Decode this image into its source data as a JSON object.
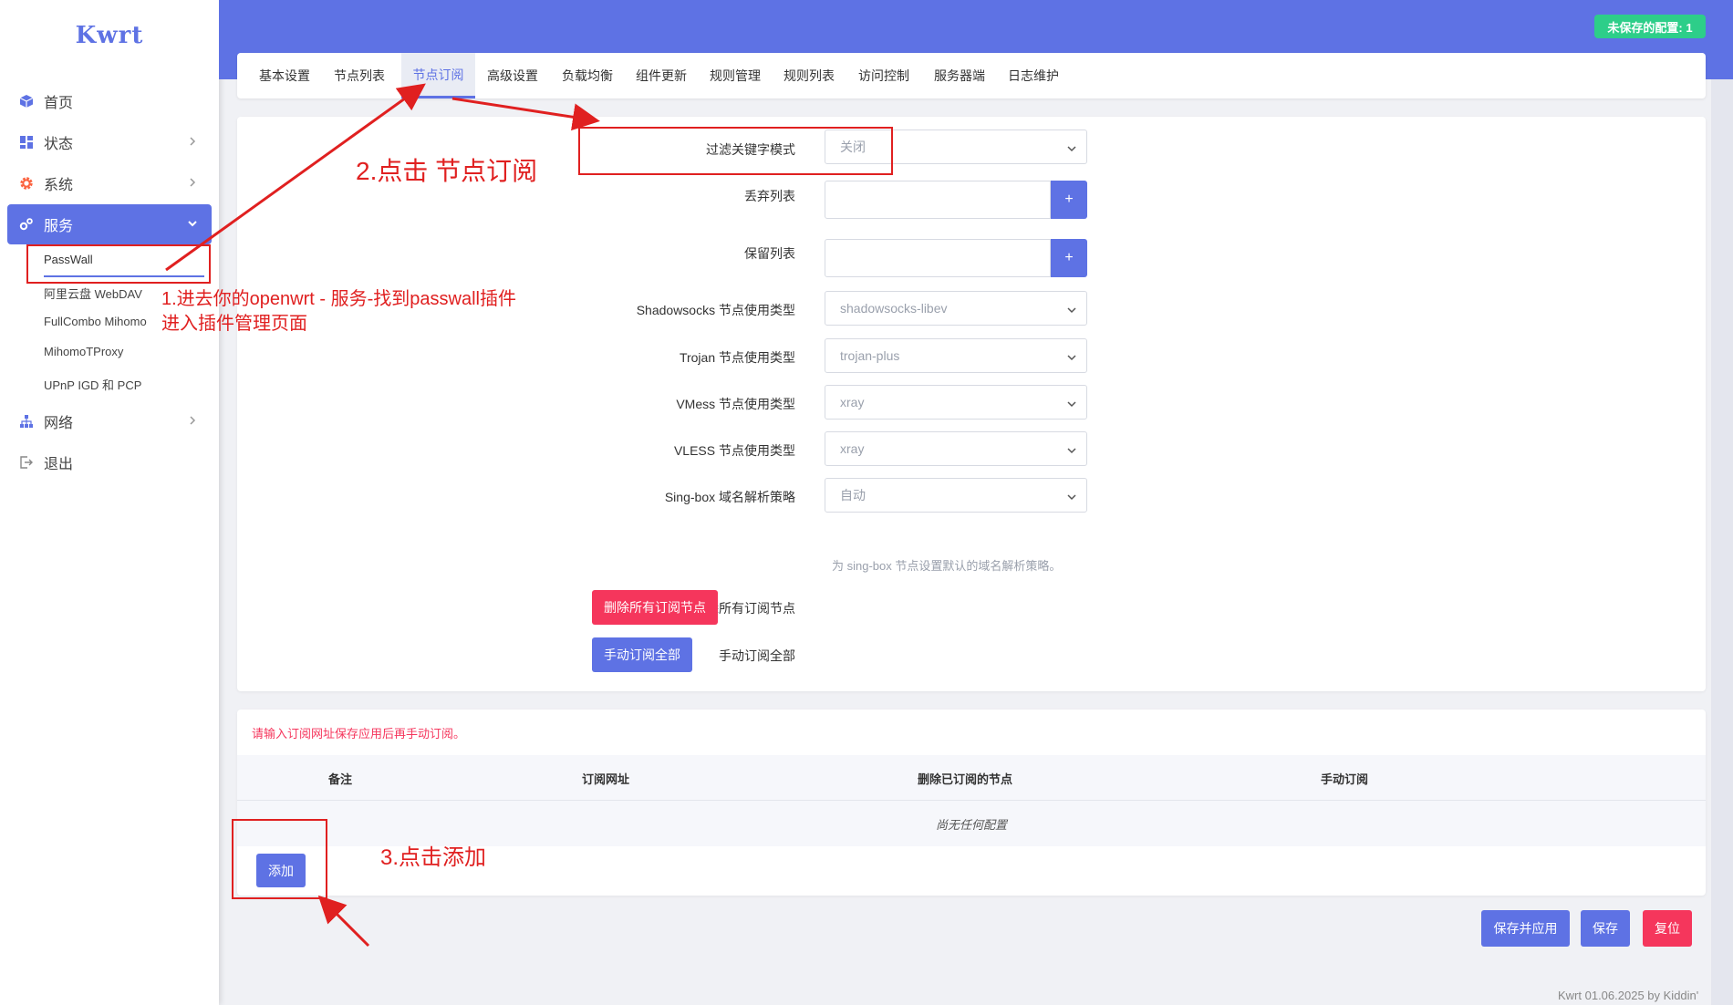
{
  "sidebar": {
    "logo": "Kwrt",
    "items": [
      {
        "label": "首页"
      },
      {
        "label": "状态"
      },
      {
        "label": "系统"
      },
      {
        "label": "服务"
      },
      {
        "label": "网络"
      },
      {
        "label": "退出"
      }
    ],
    "subitems": [
      {
        "label": "PassWall"
      },
      {
        "label": "阿里云盘 WebDAV"
      },
      {
        "label": "FullCombo Mihomo"
      },
      {
        "label": "MihomoTProxy"
      },
      {
        "label": "UPnP IGD 和 PCP"
      }
    ]
  },
  "header": {
    "unsaved": "未保存的配置: 1"
  },
  "tabs": [
    {
      "label": "基本设置"
    },
    {
      "label": "节点列表"
    },
    {
      "label": "节点订阅",
      "active": true
    },
    {
      "label": "高级设置"
    },
    {
      "label": "负载均衡"
    },
    {
      "label": "组件更新"
    },
    {
      "label": "规则管理"
    },
    {
      "label": "规则列表"
    },
    {
      "label": "访问控制"
    },
    {
      "label": "服务器端"
    },
    {
      "label": "日志维护"
    }
  ],
  "form": {
    "filter_mode_label": "过滤关键字模式",
    "filter_mode_value": "关闭",
    "discard_list_label": "丢弃列表",
    "keep_list_label": "保留列表",
    "plus": "+",
    "ss_label": "Shadowsocks 节点使用类型",
    "ss_value": "shadowsocks-libev",
    "trojan_label": "Trojan 节点使用类型",
    "trojan_value": "trojan-plus",
    "vmess_label": "VMess 节点使用类型",
    "vmess_value": "xray",
    "vless_label": "VLESS 节点使用类型",
    "vless_value": "xray",
    "singbox_label": "Sing-box 域名解析策略",
    "singbox_value": "自动",
    "singbox_hint": "为 sing-box 节点设置默认的域名解析策略。",
    "delete_all_label": "删除所有订阅节点",
    "delete_all_btn": "删除所有订阅节点",
    "manual_all_label": "手动订阅全部",
    "manual_all_btn": "手动订阅全部"
  },
  "subscriptions": {
    "warning": "请输入订阅网址保存应用后再手动订阅。",
    "columns": [
      "备注",
      "订阅网址",
      "删除已订阅的节点",
      "手动订阅"
    ],
    "empty": "尚无任何配置",
    "add_btn": "添加"
  },
  "actions": {
    "save_apply": "保存并应用",
    "save": "保存",
    "reset": "复位"
  },
  "footer": "Kwrt 01.06.2025 by Kiddin'",
  "annotations": {
    "step1_line1": "1.进去你的openwrt - 服务-找到passwall插件",
    "step1_line2": "进入插件管理页面",
    "step2": "2.点击 节点订阅",
    "step3": "3.点击添加"
  },
  "colors": {
    "accent": "#5e72e4",
    "danger": "#f5365c",
    "success": "#2dce89",
    "annotation": "#e02020"
  }
}
